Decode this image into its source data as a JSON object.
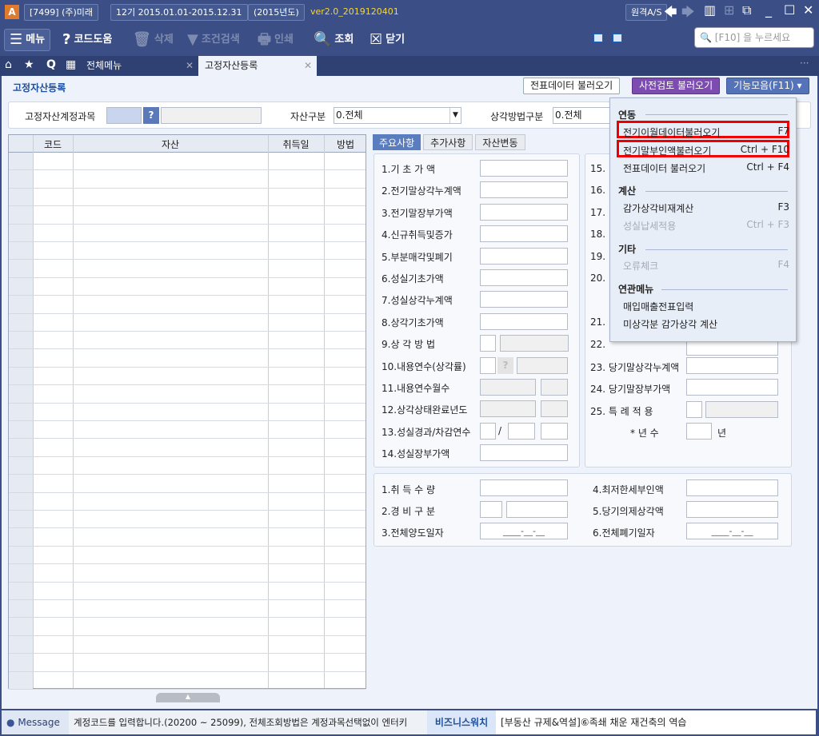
{
  "titlebar": {
    "company": "[7499] (주)미래",
    "period": "12기 2015.01.01-2015.12.31",
    "year": "(2015년도)",
    "version": "ver2.0_2019120401",
    "remote_as": "원격A/S"
  },
  "toolbar": {
    "menu": "메뉴",
    "code_help": "코드도움",
    "delete": "삭제",
    "condition_search": "조건검색",
    "print": "인쇄",
    "lookup": "조회",
    "close": "닫기",
    "search_placeholder": "[F10] 을 누르세요"
  },
  "tabs": [
    {
      "label": "전체메뉴"
    },
    {
      "label": "고정자산등록"
    }
  ],
  "page": {
    "title": "고정자산등록",
    "btn_voucher": "전표데이터 불러오기",
    "btn_precheck": "사전검토 불러오기",
    "btn_functions": "기능모음(F11)"
  },
  "filters": {
    "account_label": "고정자산계정과목",
    "asset_type_label": "자산구분",
    "asset_type_value": "0.전체",
    "method_label": "상각방법구분",
    "method_value": "0.전체"
  },
  "grid": {
    "headers": [
      "코드",
      "자산",
      "취득일",
      "방법"
    ]
  },
  "detail_tabs": [
    "주요사항",
    "추가사항",
    "자산변동"
  ],
  "left_fields": [
    "1.기    초    가    액",
    "2.전기말상각누계액",
    "3.전기말장부가액",
    "4.신규취득및증가",
    "5.부분매각및폐기",
    "6.성실기초가액",
    "7.성실상각누계액",
    "8.상각기초가액",
    "9.상    각    방    법",
    "10.내용연수(상각률)",
    "11.내용연수월수",
    "12.상각상태완료년도",
    "13.성실경과/차감연수",
    "14.성실장부가액"
  ],
  "right_fields": {
    "n15": "15.",
    "n16": "16.",
    "n17": "17.",
    "n18": "18.",
    "n19": "19.",
    "n20": "20.",
    "n21": "21.",
    "n22": "22.",
    "f23": "23. 당기말상각누계액",
    "f24": "24. 당기말장부가액",
    "f25": "25. 특    례    적    용",
    "years": "*  년  수",
    "years_unit": "년",
    "slash": "/"
  },
  "bottom_fields": {
    "qty": "1.취    득    수    량",
    "expense": "2.경    비    구    분",
    "transfer_date": "3.전체양도일자",
    "min_tax": "4.최저한세부인액",
    "current_dep": "5.당기의제상각액",
    "disposal_date": "6.전체폐기일자",
    "date_mask": "____-__-__"
  },
  "menu": {
    "sec1": "연동",
    "items1": [
      {
        "label": "전기이월데이터불러오기",
        "key": "F7"
      },
      {
        "label": "전기말부인액불러오기",
        "key": "Ctrl + F10"
      },
      {
        "label": "전표데이터 불러오기",
        "key": "Ctrl + F4"
      }
    ],
    "sec2": "계산",
    "items2": [
      {
        "label": "감가상각비재계산",
        "key": "F3"
      },
      {
        "label": "성실납세적용",
        "key": "Ctrl + F3"
      }
    ],
    "sec3": "기타",
    "items3": [
      {
        "label": "오류체크",
        "key": "F4"
      }
    ],
    "sec4": "연관메뉴",
    "items4": [
      {
        "label": "매입매출전표입력"
      },
      {
        "label": "미상각분 감가상각 계산"
      }
    ]
  },
  "status": {
    "message_label": "Message",
    "message": "계정코드를 입력합니다.(20200 ~ 25099), 전체조회방법은 계정과목선택없이 엔터키",
    "biz": "비즈니스워치",
    "news": "[부동산 규제&역설]⑥족쇄 채운 재건축의 역습"
  }
}
